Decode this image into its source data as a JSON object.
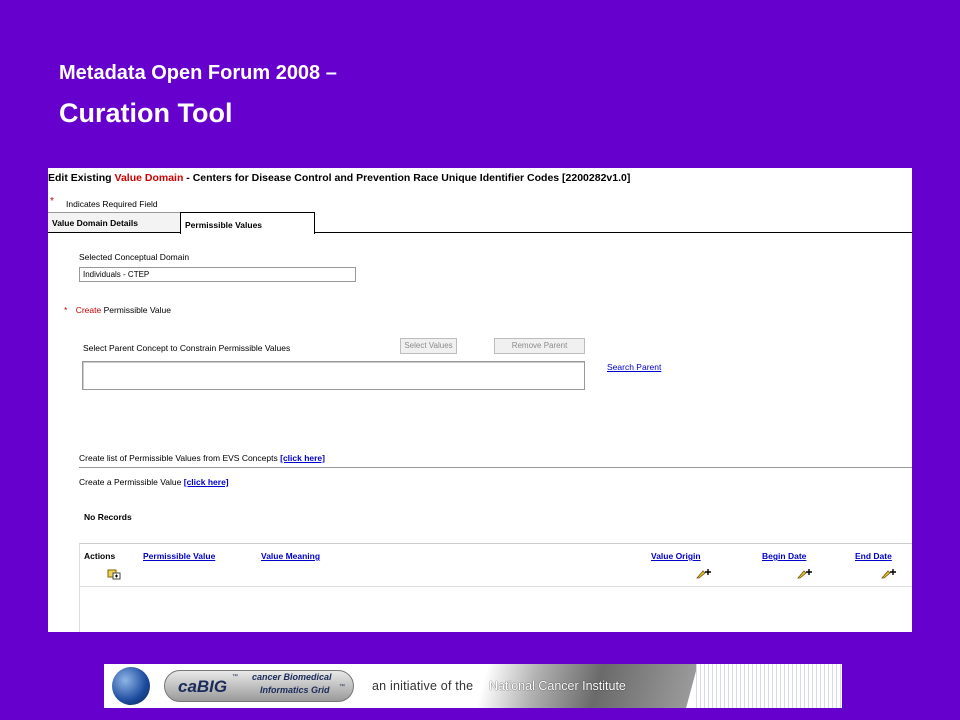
{
  "slide": {
    "title": "Metadata Open Forum 2008 –",
    "subtitle": "Curation Tool"
  },
  "app": {
    "heading_prefix": "Edit Existing",
    "heading_highlight": "Value Domain",
    "heading_suffix": "- Centers for Disease Control and Prevention Race Unique Identifier Codes [2200282v1.0]",
    "required_star": "*",
    "required_text": "Indicates Required Field",
    "tabs": [
      {
        "label": "Value Domain Details"
      },
      {
        "label": "Permissible Values"
      }
    ],
    "conceptual_domain": {
      "label": "Selected Conceptual Domain",
      "value": "Individuals - CTEP"
    },
    "create_pv": {
      "star": "*",
      "action": "Create",
      "label": "Permissible Value"
    },
    "parent": {
      "label": "Select Parent Concept to Constrain Permissible Values",
      "select_values": "Select Values",
      "remove_parent": "Remove Parent",
      "search_parent": "Search Parent"
    },
    "evs": {
      "text": "Create list of Permissible Values from EVS Concepts",
      "link": "[click here]"
    },
    "single": {
      "text": "Create a Permissible Value",
      "link": "[click here]"
    },
    "no_records": "No Records",
    "table": {
      "columns": {
        "actions": "Actions",
        "permissible_value": "Permissible Value",
        "value_meaning": "Value Meaning",
        "value_origin": "Value Origin",
        "begin_date": "Begin Date",
        "end_date": "End Date"
      }
    }
  },
  "banner": {
    "brand": "caBIG",
    "tm": "™",
    "line1": "cancer Biomedical",
    "line2": "Informatics Grid",
    "initiative": "an initiative of the",
    "nci": "National Cancer Institute"
  }
}
